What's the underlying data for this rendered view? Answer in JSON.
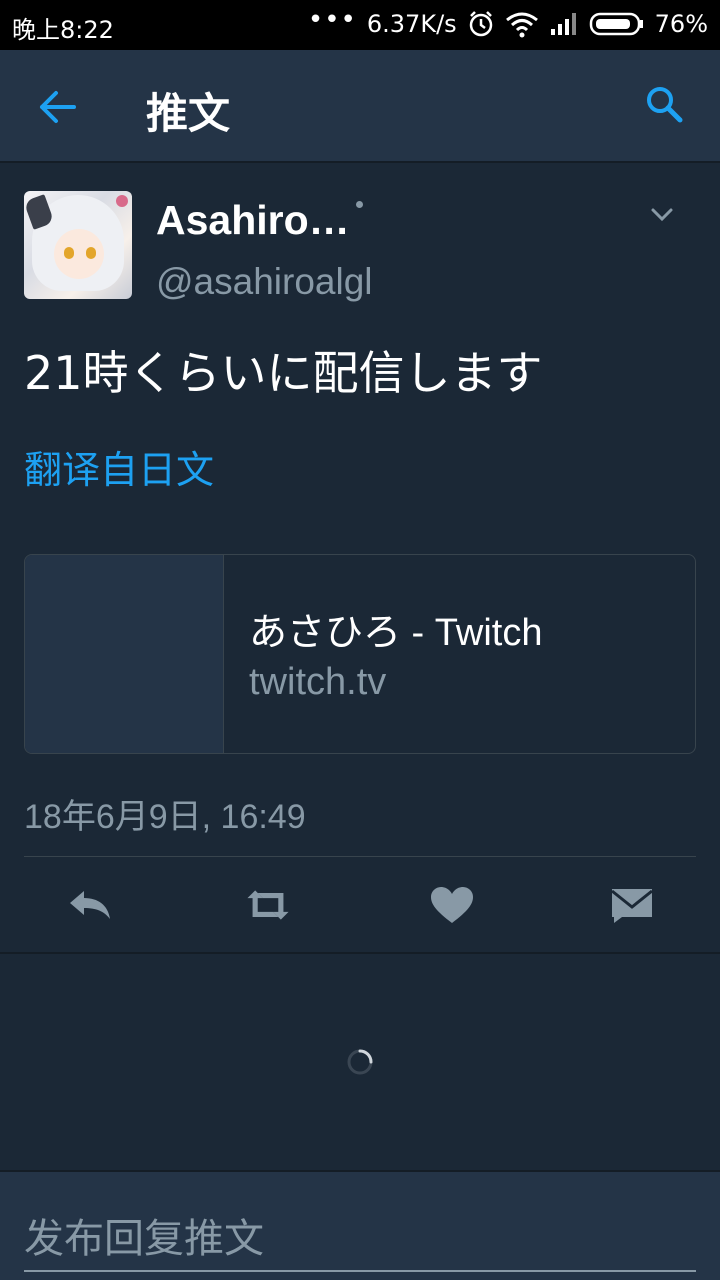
{
  "status_bar": {
    "time": "晚上8:22",
    "dots": "•••",
    "speed": "6.37K/s",
    "battery": "76%"
  },
  "toolbar": {
    "title": "推文",
    "back_icon": "back-arrow-icon",
    "search_icon": "search-icon"
  },
  "tweet": {
    "display_name": "Asahiro…",
    "handle": "@asahiroalgl",
    "text": "21時くらいに配信します",
    "translate_label": "翻译自日文",
    "card": {
      "title": "あさひろ - Twitch",
      "domain": "twitch.tv"
    },
    "timestamp": "18年6月9日, 16:49"
  },
  "actions": [
    "reply-icon",
    "retweet-icon",
    "like-icon",
    "direct-message-icon"
  ],
  "reply_bar": {
    "placeholder": "发布回复推文"
  },
  "colors": {
    "background": "#1b2836",
    "toolbar": "#243447",
    "accent": "#1da1f2",
    "secondary_text": "#8899a6"
  }
}
